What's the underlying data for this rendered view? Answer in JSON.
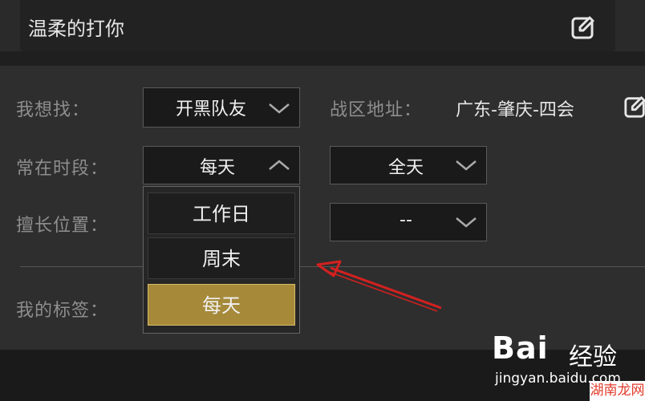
{
  "header": {
    "title": "温柔的打你"
  },
  "form": {
    "looking_for_label": "我想找：",
    "looking_for_value": "开黑队友",
    "region_label": "战区地址：",
    "region_value": "广东-肇庆-四会",
    "time_label": "常在时段：",
    "time_value": "每天",
    "time_range_value": "全天",
    "position_label": "擅长位置：",
    "position_value": "--",
    "tags_label": "我的标签："
  },
  "dropdown": {
    "options": [
      "工作日",
      "周末",
      "每天"
    ],
    "selected": "每天"
  },
  "colors": {
    "selected_option": "#a68a3a",
    "annotation_arrow": "#d42020"
  },
  "watermark": {
    "brand": "Bai",
    "brand_suffix": "经验",
    "url": "jingyan.baidu.com",
    "corner": "湖南龙网"
  }
}
